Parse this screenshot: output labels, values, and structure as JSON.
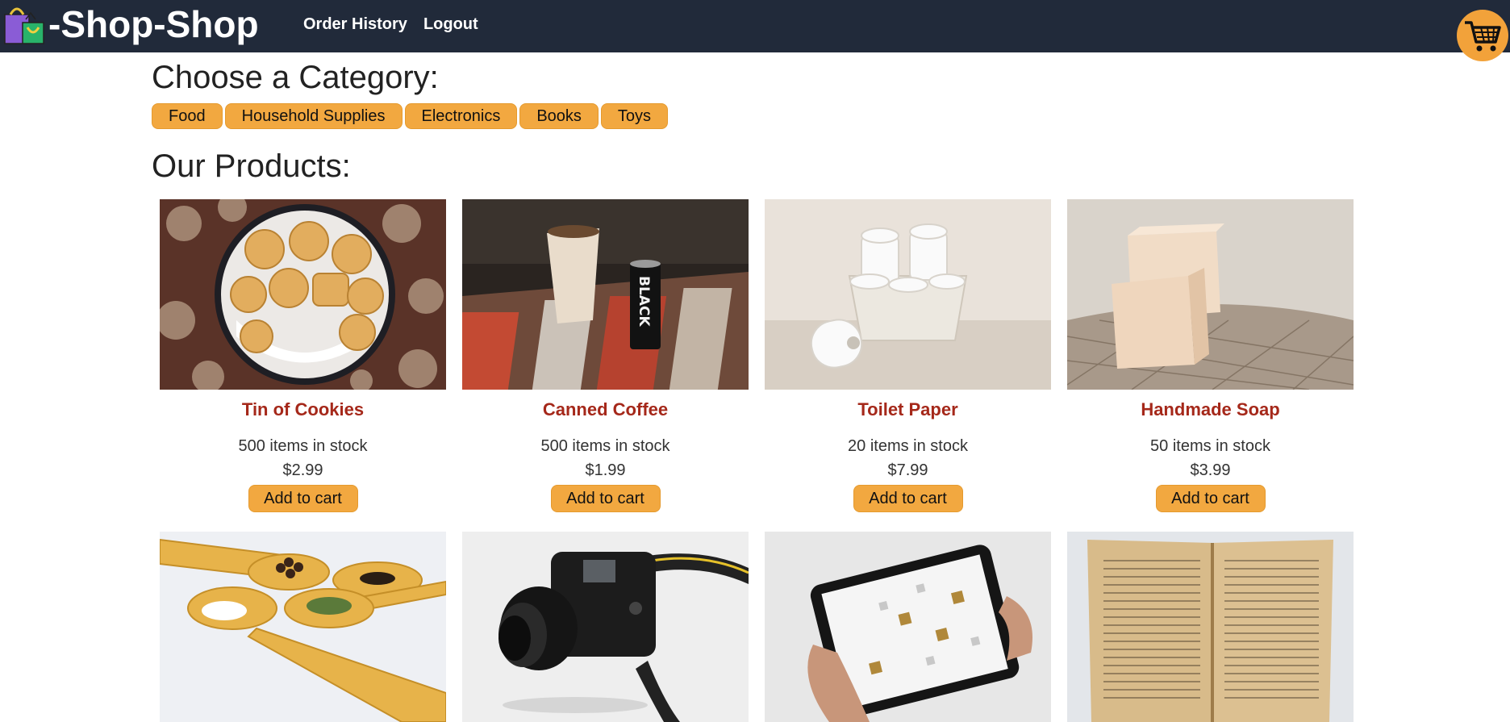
{
  "header": {
    "brand_title": "-Shop-Shop",
    "logo_icon": "shopping-bags-icon",
    "nav": [
      {
        "label": "Order History"
      },
      {
        "label": "Logout"
      }
    ],
    "cart_icon": "shopping-cart-icon",
    "colors": {
      "bar": "#212a3a",
      "accent": "#f2a840"
    }
  },
  "categories": {
    "title": "Choose a Category:",
    "items": [
      {
        "label": "Food"
      },
      {
        "label": "Household Supplies"
      },
      {
        "label": "Electronics"
      },
      {
        "label": "Books"
      },
      {
        "label": "Toys"
      }
    ]
  },
  "products": {
    "title": "Our Products:",
    "items": [
      {
        "name": "Tin of Cookies",
        "stock": "500 items in stock",
        "price": "$2.99",
        "button": "Add to cart",
        "image": "cookies-tin-photo"
      },
      {
        "name": "Canned Coffee",
        "stock": "500 items in stock",
        "price": "$1.99",
        "button": "Add to cart",
        "image": "canned-coffee-photo"
      },
      {
        "name": "Toilet Paper",
        "stock": "20 items in stock",
        "price": "$7.99",
        "button": "Add to cart",
        "image": "toilet-paper-photo"
      },
      {
        "name": "Handmade Soap",
        "stock": "50 items in stock",
        "price": "$3.99",
        "button": "Add to cart",
        "image": "soap-photo"
      },
      {
        "image": "spices-on-spoons-photo"
      },
      {
        "image": "camera-photo"
      },
      {
        "image": "tablet-photo"
      },
      {
        "image": "open-book-photo"
      }
    ]
  }
}
